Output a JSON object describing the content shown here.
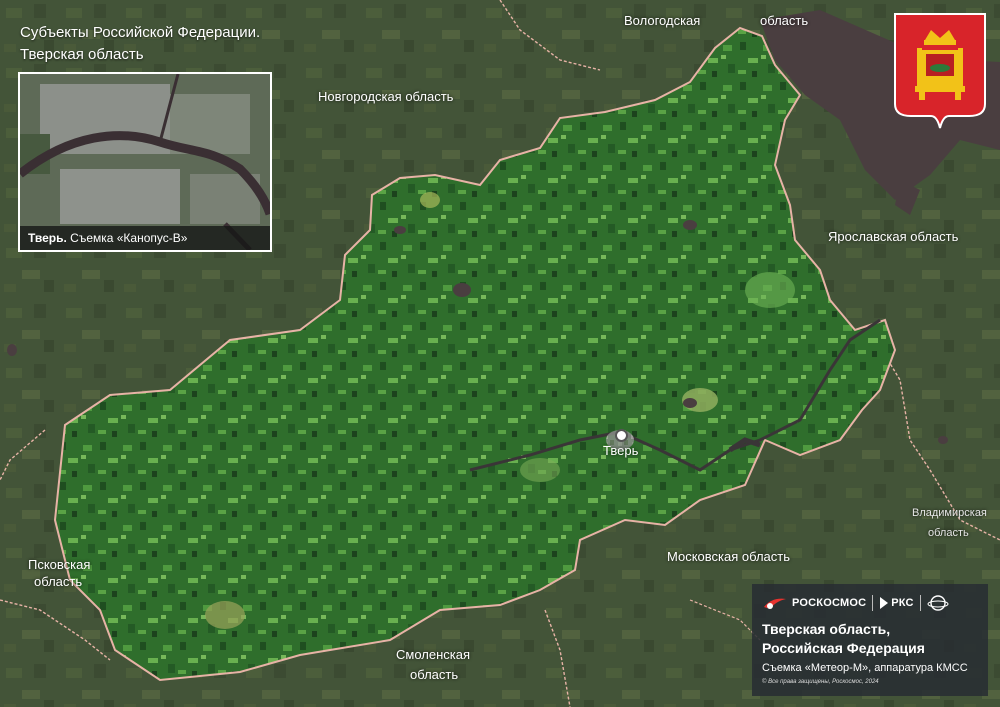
{
  "title": {
    "line1": "Субъекты Российской Федерации.",
    "line2": "Тверская область"
  },
  "inset": {
    "caption_bold": "Тверь.",
    "caption_rest": " Съемка «Канопус-В»"
  },
  "regions": {
    "novgorod": "Новгородская область",
    "vologda_1": "Вологодская",
    "vologda_2": "область",
    "yaroslavl": "Ярославская область",
    "vladimir_1": "Владимирская",
    "vladimir_2": "область",
    "moscow": "Московская область",
    "smolensk_1": "Смоленская",
    "smolensk_2": "область",
    "pskov_1": "Псковская",
    "pskov_2": "область"
  },
  "city": {
    "name": "Тверь"
  },
  "panel": {
    "logo_roscosmos": "РОСКОСМОС",
    "logo_rks": "РКС",
    "title_line1": "Тверская область,",
    "title_line2": "Российская Федерация",
    "subtitle": "Съемка «Метеор-М», аппаратура КМСС",
    "copyright": "© Все права защищены, Роскосмос, 2024"
  },
  "colors": {
    "region_fill": "#2f6e2c",
    "border": "#e7b3a6",
    "water": "#4a3e40",
    "emblem_red": "#d8242a",
    "emblem_gold": "#f2c218",
    "panel_bg": "#2a2e34"
  },
  "icons": {
    "roscosmos_logo": "roscosmos-logo-icon",
    "rks_logo": "rks-logo-icon",
    "emblem": "coat-of-arms-icon"
  }
}
